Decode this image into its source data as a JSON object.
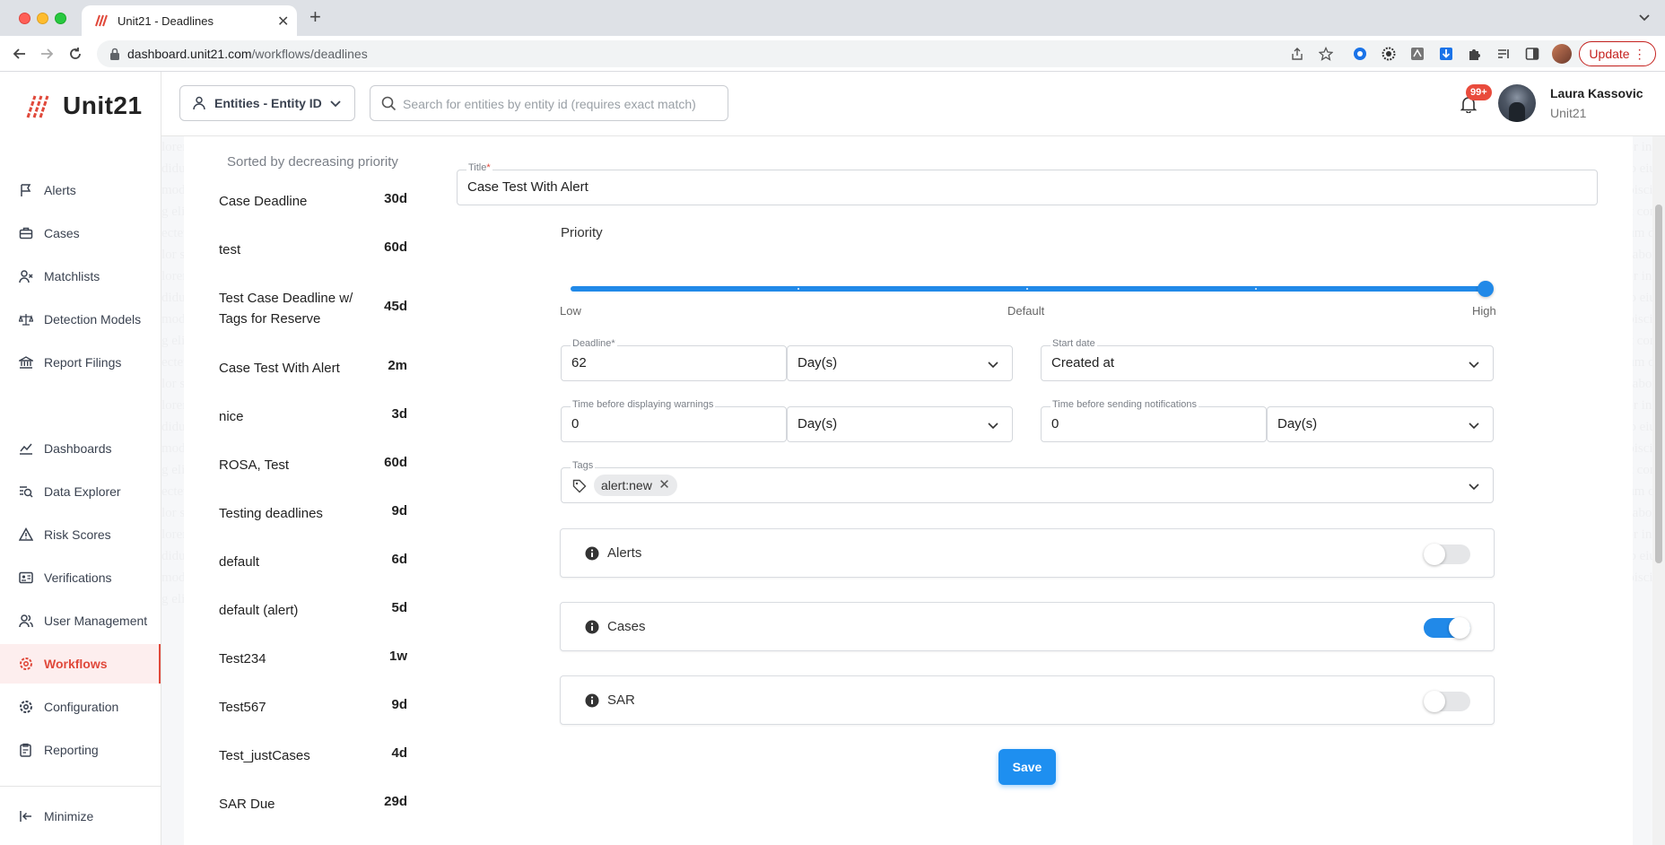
{
  "browser": {
    "tab_title": "Unit21 - Deadlines",
    "url_host": "dashboard.unit21.com",
    "url_path": "/workflows/deadlines",
    "update_label": "Update",
    "update_dots": "⋮"
  },
  "app": {
    "logo_text": "Unit21",
    "brand_color": "#e0493b",
    "accent_color": "#2189e8"
  },
  "sidebar": {
    "items": [
      {
        "label": "Alerts",
        "icon": "flag-icon"
      },
      {
        "label": "Cases",
        "icon": "briefcase-icon"
      },
      {
        "label": "Matchlists",
        "icon": "user-x-icon"
      },
      {
        "label": "Detection Models",
        "icon": "scale-icon"
      },
      {
        "label": "Report Filings",
        "icon": "bank-icon"
      },
      {
        "label": "Dashboards",
        "icon": "chart-line-icon"
      },
      {
        "label": "Data Explorer",
        "icon": "data-search-icon"
      },
      {
        "label": "Risk Scores",
        "icon": "warning-icon"
      },
      {
        "label": "Verifications",
        "icon": "id-card-icon"
      },
      {
        "label": "User Management",
        "icon": "users-icon"
      },
      {
        "label": "Workflows",
        "icon": "workflow-gear-icon",
        "active": true
      },
      {
        "label": "Configuration",
        "icon": "gear-icon"
      },
      {
        "label": "Reporting",
        "icon": "clipboard-icon"
      }
    ],
    "minimize_label": "Minimize"
  },
  "header": {
    "entity_select": "Entities - Entity ID",
    "search_placeholder": "Search for entities by entity id (requires exact match)",
    "notifications_badge": "99+",
    "user_name": "Laura Kassovic",
    "user_org": "Unit21"
  },
  "deadlines": {
    "caption": "Sorted by decreasing priority",
    "items": [
      {
        "name": "Case Deadline",
        "value": "30d"
      },
      {
        "name": "test",
        "value": "60d"
      },
      {
        "name": "Test Case Deadline w/ Tags for Reserve",
        "value": "45d"
      },
      {
        "name": "Case Test With Alert",
        "value": "2m"
      },
      {
        "name": "nice",
        "value": "3d"
      },
      {
        "name": "ROSA, Test",
        "value": "60d"
      },
      {
        "name": "Testing deadlines",
        "value": "9d"
      },
      {
        "name": "default",
        "value": "6d"
      },
      {
        "name": "default (alert)",
        "value": "5d"
      },
      {
        "name": "Test234",
        "value": "1w"
      },
      {
        "name": "Test567",
        "value": "9d"
      },
      {
        "name": "Test_justCases",
        "value": "4d"
      },
      {
        "name": "SAR Due",
        "value": "29d"
      }
    ]
  },
  "form": {
    "title_label": "Title",
    "title_value": "Case Test With Alert",
    "priority_label": "Priority",
    "priority_low": "Low",
    "priority_default": "Default",
    "priority_high": "High",
    "priority_level": 1.0,
    "deadline_label": "Deadline",
    "deadline_value": "62",
    "deadline_unit": "Day(s)",
    "start_date_label": "Start date",
    "start_date_value": "Created at",
    "warnings_label": "Time before displaying warnings",
    "warnings_value": "0",
    "warnings_unit": "Day(s)",
    "notifications_label": "Time before sending notifications",
    "notifications_value": "0",
    "notifications_unit": "Day(s)",
    "tags_label": "Tags",
    "tags": [
      "alert:new"
    ],
    "toggles": [
      {
        "label": "Alerts",
        "on": false
      },
      {
        "label": "Cases",
        "on": true
      },
      {
        "label": "SAR",
        "on": false
      }
    ],
    "save_label": "Save"
  }
}
